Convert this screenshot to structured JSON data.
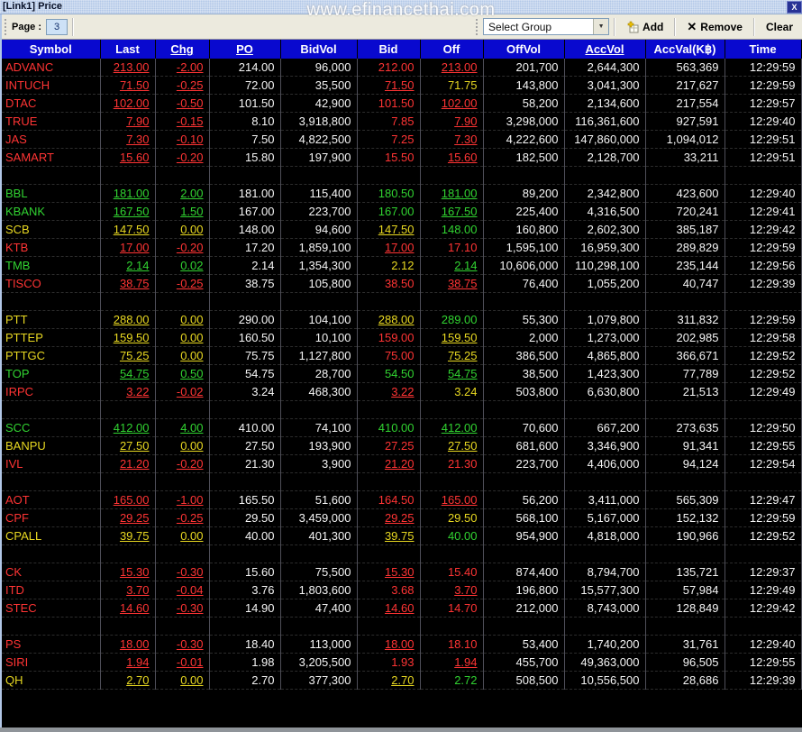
{
  "window": {
    "title": "[Link1] Price",
    "watermark": "www.efinancethai.com",
    "close_glyph": "X"
  },
  "toolbar": {
    "page_label": "Page :",
    "page_value": "3",
    "group_select_value": "Select Group",
    "dropdown_glyph": "▼",
    "add_label": "Add",
    "remove_label": "Remove",
    "remove_glyph": "✕",
    "clear_label": "Clear"
  },
  "colors": {
    "down": "#ff3434",
    "up": "#31d331",
    "unchanged": "#e8d821",
    "neutral": "#f5f5f5",
    "header_bg": "#0909cf"
  },
  "table": {
    "columns": [
      {
        "label": "Symbol",
        "underlined": false
      },
      {
        "label": "Last",
        "underlined": false
      },
      {
        "label": "Chg",
        "underlined": true
      },
      {
        "label": "PO",
        "underlined": true
      },
      {
        "label": "BidVol",
        "underlined": false
      },
      {
        "label": "Bid",
        "underlined": false
      },
      {
        "label": "Off",
        "underlined": false
      },
      {
        "label": "OffVol",
        "underlined": false
      },
      {
        "label": "AccVol",
        "underlined": true
      },
      {
        "label": "AccVal(K฿)",
        "underlined": false
      },
      {
        "label": "Time",
        "underlined": false
      }
    ],
    "groups": [
      {
        "rows": [
          {
            "symbol": "ADVANC",
            "trend": "down",
            "last": "213.00",
            "chg": "-2.00",
            "po": "214.00",
            "bid_vol": "96,000",
            "bid": "212.00",
            "bid_trend": "down",
            "bid_exec": false,
            "off": "213.00",
            "off_trend": "down",
            "off_exec": true,
            "off_vol": "201,700",
            "acc_vol": "2,644,300",
            "acc_val": "563,369",
            "time": "12:29:59"
          },
          {
            "symbol": "INTUCH",
            "trend": "down",
            "last": "71.50",
            "chg": "-0.25",
            "po": "72.00",
            "bid_vol": "35,500",
            "bid": "71.50",
            "bid_trend": "down",
            "bid_exec": true,
            "off": "71.75",
            "off_trend": "unch",
            "off_exec": false,
            "off_vol": "143,800",
            "acc_vol": "3,041,300",
            "acc_val": "217,627",
            "time": "12:29:59"
          },
          {
            "symbol": "DTAC",
            "trend": "down",
            "last": "102.00",
            "chg": "-0.50",
            "po": "101.50",
            "bid_vol": "42,900",
            "bid": "101.50",
            "bid_trend": "down",
            "bid_exec": false,
            "off": "102.00",
            "off_trend": "down",
            "off_exec": true,
            "off_vol": "58,200",
            "acc_vol": "2,134,600",
            "acc_val": "217,554",
            "time": "12:29:57"
          },
          {
            "symbol": "TRUE",
            "trend": "down",
            "last": "7.90",
            "chg": "-0.15",
            "po": "8.10",
            "bid_vol": "3,918,800",
            "bid": "7.85",
            "bid_trend": "down",
            "bid_exec": false,
            "off": "7.90",
            "off_trend": "down",
            "off_exec": true,
            "off_vol": "3,298,000",
            "acc_vol": "116,361,600",
            "acc_val": "927,591",
            "time": "12:29:40"
          },
          {
            "symbol": "JAS",
            "trend": "down",
            "last": "7.30",
            "chg": "-0.10",
            "po": "7.50",
            "bid_vol": "4,822,500",
            "bid": "7.25",
            "bid_trend": "down",
            "bid_exec": false,
            "off": "7.30",
            "off_trend": "down",
            "off_exec": true,
            "off_vol": "4,222,600",
            "acc_vol": "147,860,000",
            "acc_val": "1,094,012",
            "time": "12:29:51"
          },
          {
            "symbol": "SAMART",
            "trend": "down",
            "last": "15.60",
            "chg": "-0.20",
            "po": "15.80",
            "bid_vol": "197,900",
            "bid": "15.50",
            "bid_trend": "down",
            "bid_exec": false,
            "off": "15.60",
            "off_trend": "down",
            "off_exec": true,
            "off_vol": "182,500",
            "acc_vol": "2,128,700",
            "acc_val": "33,211",
            "time": "12:29:51"
          }
        ]
      },
      {
        "rows": [
          {
            "symbol": "BBL",
            "trend": "up",
            "last": "181.00",
            "chg": "2.00",
            "po": "181.00",
            "bid_vol": "115,400",
            "bid": "180.50",
            "bid_trend": "up",
            "bid_exec": false,
            "off": "181.00",
            "off_trend": "up",
            "off_exec": true,
            "off_vol": "89,200",
            "acc_vol": "2,342,800",
            "acc_val": "423,600",
            "time": "12:29:40"
          },
          {
            "symbol": "KBANK",
            "trend": "up",
            "last": "167.50",
            "chg": "1.50",
            "po": "167.00",
            "bid_vol": "223,700",
            "bid": "167.00",
            "bid_trend": "up",
            "bid_exec": false,
            "off": "167.50",
            "off_trend": "up",
            "off_exec": true,
            "off_vol": "225,400",
            "acc_vol": "4,316,500",
            "acc_val": "720,241",
            "time": "12:29:41"
          },
          {
            "symbol": "SCB",
            "trend": "unch",
            "last": "147.50",
            "chg": "0.00",
            "po": "148.00",
            "bid_vol": "94,600",
            "bid": "147.50",
            "bid_trend": "unch",
            "bid_exec": true,
            "off": "148.00",
            "off_trend": "up",
            "off_exec": false,
            "off_vol": "160,800",
            "acc_vol": "2,602,300",
            "acc_val": "385,187",
            "time": "12:29:42"
          },
          {
            "symbol": "KTB",
            "trend": "down",
            "last": "17.00",
            "chg": "-0.20",
            "po": "17.20",
            "bid_vol": "1,859,100",
            "bid": "17.00",
            "bid_trend": "down",
            "bid_exec": true,
            "off": "17.10",
            "off_trend": "down",
            "off_exec": false,
            "off_vol": "1,595,100",
            "acc_vol": "16,959,300",
            "acc_val": "289,829",
            "time": "12:29:59"
          },
          {
            "symbol": "TMB",
            "trend": "up",
            "last": "2.14",
            "chg": "0.02",
            "po": "2.14",
            "bid_vol": "1,354,300",
            "bid": "2.12",
            "bid_trend": "unch",
            "bid_exec": false,
            "off": "2.14",
            "off_trend": "up",
            "off_exec": true,
            "off_vol": "10,606,000",
            "acc_vol": "110,298,100",
            "acc_val": "235,144",
            "time": "12:29:56"
          },
          {
            "symbol": "TISCO",
            "trend": "down",
            "last": "38.75",
            "chg": "-0.25",
            "po": "38.75",
            "bid_vol": "105,800",
            "bid": "38.50",
            "bid_trend": "down",
            "bid_exec": false,
            "off": "38.75",
            "off_trend": "down",
            "off_exec": true,
            "off_vol": "76,400",
            "acc_vol": "1,055,200",
            "acc_val": "40,747",
            "time": "12:29:39"
          }
        ]
      },
      {
        "rows": [
          {
            "symbol": "PTT",
            "trend": "unch",
            "last": "288.00",
            "chg": "0.00",
            "po": "290.00",
            "bid_vol": "104,100",
            "bid": "288.00",
            "bid_trend": "unch",
            "bid_exec": true,
            "off": "289.00",
            "off_trend": "up",
            "off_exec": false,
            "off_vol": "55,300",
            "acc_vol": "1,079,800",
            "acc_val": "311,832",
            "time": "12:29:59"
          },
          {
            "symbol": "PTTEP",
            "trend": "unch",
            "last": "159.50",
            "chg": "0.00",
            "po": "160.50",
            "bid_vol": "10,100",
            "bid": "159.00",
            "bid_trend": "down",
            "bid_exec": false,
            "off": "159.50",
            "off_trend": "unch",
            "off_exec": true,
            "off_vol": "2,000",
            "acc_vol": "1,273,000",
            "acc_val": "202,985",
            "time": "12:29:58"
          },
          {
            "symbol": "PTTGC",
            "trend": "unch",
            "last": "75.25",
            "chg": "0.00",
            "po": "75.75",
            "bid_vol": "1,127,800",
            "bid": "75.00",
            "bid_trend": "down",
            "bid_exec": false,
            "off": "75.25",
            "off_trend": "unch",
            "off_exec": true,
            "off_vol": "386,500",
            "acc_vol": "4,865,800",
            "acc_val": "366,671",
            "time": "12:29:52"
          },
          {
            "symbol": "TOP",
            "trend": "up",
            "last": "54.75",
            "chg": "0.50",
            "po": "54.75",
            "bid_vol": "28,700",
            "bid": "54.50",
            "bid_trend": "up",
            "bid_exec": false,
            "off": "54.75",
            "off_trend": "up",
            "off_exec": true,
            "off_vol": "38,500",
            "acc_vol": "1,423,300",
            "acc_val": "77,789",
            "time": "12:29:52"
          },
          {
            "symbol": "IRPC",
            "trend": "down",
            "last": "3.22",
            "chg": "-0.02",
            "po": "3.24",
            "bid_vol": "468,300",
            "bid": "3.22",
            "bid_trend": "down",
            "bid_exec": true,
            "off": "3.24",
            "off_trend": "unch",
            "off_exec": false,
            "off_vol": "503,800",
            "acc_vol": "6,630,800",
            "acc_val": "21,513",
            "time": "12:29:49"
          }
        ]
      },
      {
        "rows": [
          {
            "symbol": "SCC",
            "trend": "up",
            "last": "412.00",
            "chg": "4.00",
            "po": "410.00",
            "bid_vol": "74,100",
            "bid": "410.00",
            "bid_trend": "up",
            "bid_exec": false,
            "off": "412.00",
            "off_trend": "up",
            "off_exec": true,
            "off_vol": "70,600",
            "acc_vol": "667,200",
            "acc_val": "273,635",
            "time": "12:29:50"
          },
          {
            "symbol": "BANPU",
            "trend": "unch",
            "last": "27.50",
            "chg": "0.00",
            "po": "27.50",
            "bid_vol": "193,900",
            "bid": "27.25",
            "bid_trend": "down",
            "bid_exec": false,
            "off": "27.50",
            "off_trend": "unch",
            "off_exec": true,
            "off_vol": "681,600",
            "acc_vol": "3,346,900",
            "acc_val": "91,341",
            "time": "12:29:55"
          },
          {
            "symbol": "IVL",
            "trend": "down",
            "last": "21.20",
            "chg": "-0.20",
            "po": "21.30",
            "bid_vol": "3,900",
            "bid": "21.20",
            "bid_trend": "down",
            "bid_exec": true,
            "off": "21.30",
            "off_trend": "down",
            "off_exec": false,
            "off_vol": "223,700",
            "acc_vol": "4,406,000",
            "acc_val": "94,124",
            "time": "12:29:54"
          }
        ]
      },
      {
        "rows": [
          {
            "symbol": "AOT",
            "trend": "down",
            "last": "165.00",
            "chg": "-1.00",
            "po": "165.50",
            "bid_vol": "51,600",
            "bid": "164.50",
            "bid_trend": "down",
            "bid_exec": false,
            "off": "165.00",
            "off_trend": "down",
            "off_exec": true,
            "off_vol": "56,200",
            "acc_vol": "3,411,000",
            "acc_val": "565,309",
            "time": "12:29:47"
          },
          {
            "symbol": "CPF",
            "trend": "down",
            "last": "29.25",
            "chg": "-0.25",
            "po": "29.50",
            "bid_vol": "3,459,000",
            "bid": "29.25",
            "bid_trend": "down",
            "bid_exec": true,
            "off": "29.50",
            "off_trend": "unch",
            "off_exec": false,
            "off_vol": "568,100",
            "acc_vol": "5,167,000",
            "acc_val": "152,132",
            "time": "12:29:59"
          },
          {
            "symbol": "CPALL",
            "trend": "unch",
            "last": "39.75",
            "chg": "0.00",
            "po": "40.00",
            "bid_vol": "401,300",
            "bid": "39.75",
            "bid_trend": "unch",
            "bid_exec": true,
            "off": "40.00",
            "off_trend": "up",
            "off_exec": false,
            "off_vol": "954,900",
            "acc_vol": "4,818,000",
            "acc_val": "190,966",
            "time": "12:29:52"
          }
        ]
      },
      {
        "rows": [
          {
            "symbol": "CK",
            "trend": "down",
            "last": "15.30",
            "chg": "-0.30",
            "po": "15.60",
            "bid_vol": "75,500",
            "bid": "15.30",
            "bid_trend": "down",
            "bid_exec": true,
            "off": "15.40",
            "off_trend": "down",
            "off_exec": false,
            "off_vol": "874,400",
            "acc_vol": "8,794,700",
            "acc_val": "135,721",
            "time": "12:29:37"
          },
          {
            "symbol": "ITD",
            "trend": "down",
            "last": "3.70",
            "chg": "-0.04",
            "po": "3.76",
            "bid_vol": "1,803,600",
            "bid": "3.68",
            "bid_trend": "down",
            "bid_exec": false,
            "off": "3.70",
            "off_trend": "down",
            "off_exec": true,
            "off_vol": "196,800",
            "acc_vol": "15,577,300",
            "acc_val": "57,984",
            "time": "12:29:49"
          },
          {
            "symbol": "STEC",
            "trend": "down",
            "last": "14.60",
            "chg": "-0.30",
            "po": "14.90",
            "bid_vol": "47,400",
            "bid": "14.60",
            "bid_trend": "down",
            "bid_exec": true,
            "off": "14.70",
            "off_trend": "down",
            "off_exec": false,
            "off_vol": "212,000",
            "acc_vol": "8,743,000",
            "acc_val": "128,849",
            "time": "12:29:42"
          }
        ]
      },
      {
        "rows": [
          {
            "symbol": "PS",
            "trend": "down",
            "last": "18.00",
            "chg": "-0.30",
            "po": "18.40",
            "bid_vol": "113,000",
            "bid": "18.00",
            "bid_trend": "down",
            "bid_exec": true,
            "off": "18.10",
            "off_trend": "down",
            "off_exec": false,
            "off_vol": "53,400",
            "acc_vol": "1,740,200",
            "acc_val": "31,761",
            "time": "12:29:40"
          },
          {
            "symbol": "SIRI",
            "trend": "down",
            "last": "1.94",
            "chg": "-0.01",
            "po": "1.98",
            "bid_vol": "3,205,500",
            "bid": "1.93",
            "bid_trend": "down",
            "bid_exec": false,
            "off": "1.94",
            "off_trend": "down",
            "off_exec": true,
            "off_vol": "455,700",
            "acc_vol": "49,363,000",
            "acc_val": "96,505",
            "time": "12:29:55"
          },
          {
            "symbol": "QH",
            "trend": "unch",
            "last": "2.70",
            "chg": "0.00",
            "po": "2.70",
            "bid_vol": "377,300",
            "bid": "2.70",
            "bid_trend": "unch",
            "bid_exec": true,
            "off": "2.72",
            "off_trend": "up",
            "off_exec": false,
            "off_vol": "508,500",
            "acc_vol": "10,556,500",
            "acc_val": "28,686",
            "time": "12:29:39"
          }
        ]
      }
    ]
  }
}
